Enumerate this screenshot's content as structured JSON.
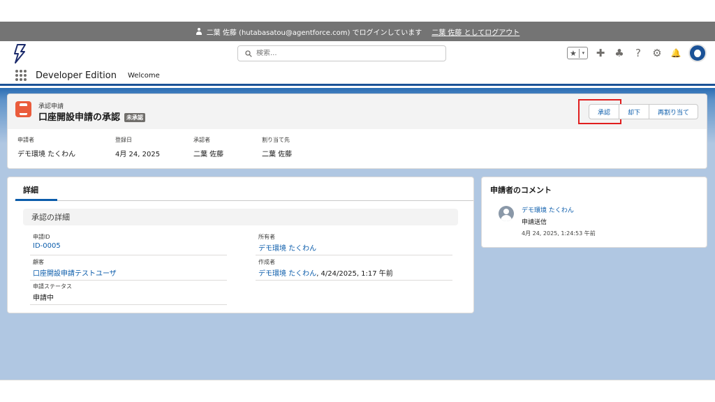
{
  "login_bar": {
    "message": "二葉 佐藤 (hutabasatou@agentforce.com) でログインしています",
    "logout_link": "二葉 佐藤 としてログアウト"
  },
  "header": {
    "search_placeholder": "検索...",
    "favorites_star": "★",
    "favorites_caret": "▾",
    "icons": {
      "add": "✚",
      "trailhead": "♣",
      "help": "?",
      "setup": "⚙",
      "notifications": "🔔"
    }
  },
  "app_nav": {
    "app_name": "Developer Edition",
    "tabs": [
      "Welcome"
    ]
  },
  "record": {
    "object_label": "承認申請",
    "title": "口座開設申請の承認",
    "status_badge": "未承認",
    "actions": {
      "approve": "承認",
      "reject": "却下",
      "reassign": "再割り当て"
    },
    "highlight_fields": [
      {
        "label": "申請者",
        "value": "デモ環境 たくわん"
      },
      {
        "label": "登録日",
        "value": "4月 24, 2025"
      },
      {
        "label": "承認者",
        "value": "二葉 佐藤"
      },
      {
        "label": "割り当て先",
        "value": "二葉 佐藤"
      }
    ]
  },
  "details": {
    "tab_label": "詳細",
    "section_title": "承認の詳細",
    "fields": {
      "request_id": {
        "label": "申請ID",
        "value": "ID-0005"
      },
      "owner": {
        "label": "所有者",
        "value": "デモ環境 たくわん"
      },
      "customer": {
        "label": "顧客",
        "value": "口座開設申請テストユーザ"
      },
      "created_by": {
        "label": "作成者",
        "value": "デモ環境 たくわん",
        "suffix": ", 4/24/2025, 1:17 午前"
      },
      "request_status": {
        "label": "申請ステータス",
        "value": "申請中"
      }
    }
  },
  "comments": {
    "title": "申請者のコメント",
    "items": [
      {
        "author": "デモ環境 たくわん",
        "text": "申請送信",
        "time": "4月 24, 2025, 1:24:53 午前"
      }
    ]
  },
  "colors": {
    "brand": "#1b5297",
    "link": "#0b5cab",
    "record_icon": "#ea5c3c",
    "highlight_box": "#e01e1e",
    "login_bar": "#747474"
  }
}
